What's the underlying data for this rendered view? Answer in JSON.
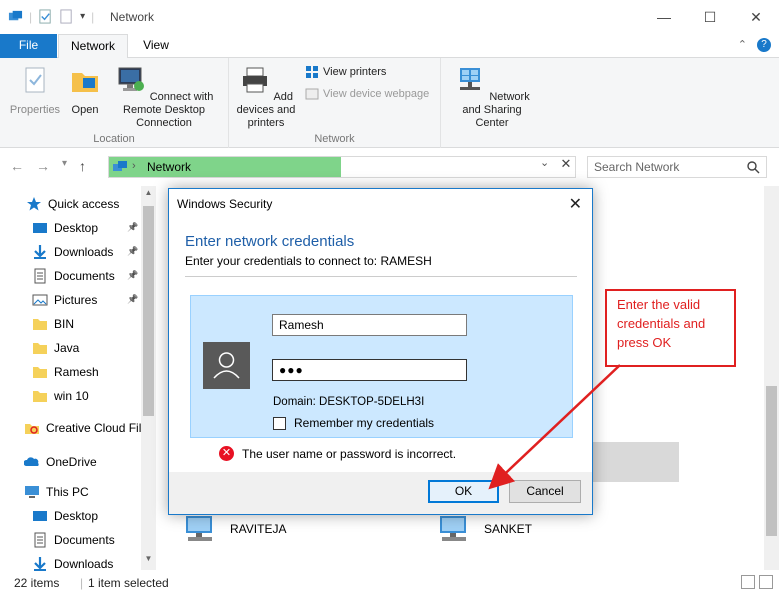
{
  "window": {
    "title": "Network",
    "controls": [
      "—",
      "☐",
      "✕"
    ]
  },
  "ribbon_tabs": [
    {
      "label": "File"
    },
    {
      "label": "Network"
    },
    {
      "label": "View"
    }
  ],
  "ribbon": {
    "location_group": {
      "label": "Location",
      "properties": "Properties",
      "open": "Open",
      "connect_rd": "Connect with Remote Desktop Connection"
    },
    "network_group": {
      "label": "Network",
      "add_devices": "Add devices and printers",
      "view_printers": "View printers",
      "view_webpage": "View device webpage"
    },
    "nsc_group": {
      "network_sharing": "Network and Sharing Center"
    }
  },
  "address_bar": {
    "path": "Network",
    "search_placeholder": "Search Network"
  },
  "nav_pane": {
    "items": [
      {
        "label": "Quick access",
        "icon": "star-icon",
        "pinned": false
      },
      {
        "label": "Desktop",
        "icon": "desktop-icon",
        "pinned": true
      },
      {
        "label": "Downloads",
        "icon": "download-icon",
        "pinned": true
      },
      {
        "label": "Documents",
        "icon": "documents-icon",
        "pinned": true
      },
      {
        "label": "Pictures",
        "icon": "pictures-icon",
        "pinned": true
      },
      {
        "label": "BIN",
        "icon": "folder-icon",
        "pinned": false
      },
      {
        "label": "Java",
        "icon": "folder-icon",
        "pinned": false
      },
      {
        "label": "Ramesh",
        "icon": "folder-icon",
        "pinned": false
      },
      {
        "label": "win 10",
        "icon": "folder-icon",
        "pinned": false
      },
      {
        "label": "Creative Cloud Fil",
        "icon": "creative-cloud-icon",
        "pinned": false
      },
      {
        "label": "OneDrive",
        "icon": "onedrive-icon",
        "pinned": false
      },
      {
        "label": "This PC",
        "icon": "this-pc-icon",
        "pinned": false
      },
      {
        "label": "Desktop",
        "icon": "desktop-icon",
        "pinned": false
      },
      {
        "label": "Documents",
        "icon": "documents-icon",
        "pinned": false
      },
      {
        "label": "Downloads",
        "icon": "download-icon",
        "pinned": false
      }
    ]
  },
  "content": {
    "computers": [
      {
        "name": "RAVITEJA"
      },
      {
        "name": "SANKET"
      }
    ]
  },
  "status_bar": {
    "items_count": "22 items",
    "selected": "1 item selected"
  },
  "dialog": {
    "title": "Windows Security",
    "heading": "Enter network credentials",
    "subtitle": "Enter your credentials to connect to: RAMESH",
    "username_value": "Ramesh",
    "password_value": "●●●",
    "domain": "Domain: DESKTOP-5DELH3I",
    "remember_label": "Remember my credentials",
    "remember_checked": false,
    "error": "The user name or password is incorrect.",
    "ok_label": "OK",
    "cancel_label": "Cancel"
  },
  "annotation": {
    "text": "Enter the valid credentials and press OK",
    "color": "#e02020"
  },
  "colors": {
    "accent": "#1979ca",
    "address_highlight": "#7fd48a",
    "cred_panel": "#cce8ff",
    "error": "#e81123"
  }
}
